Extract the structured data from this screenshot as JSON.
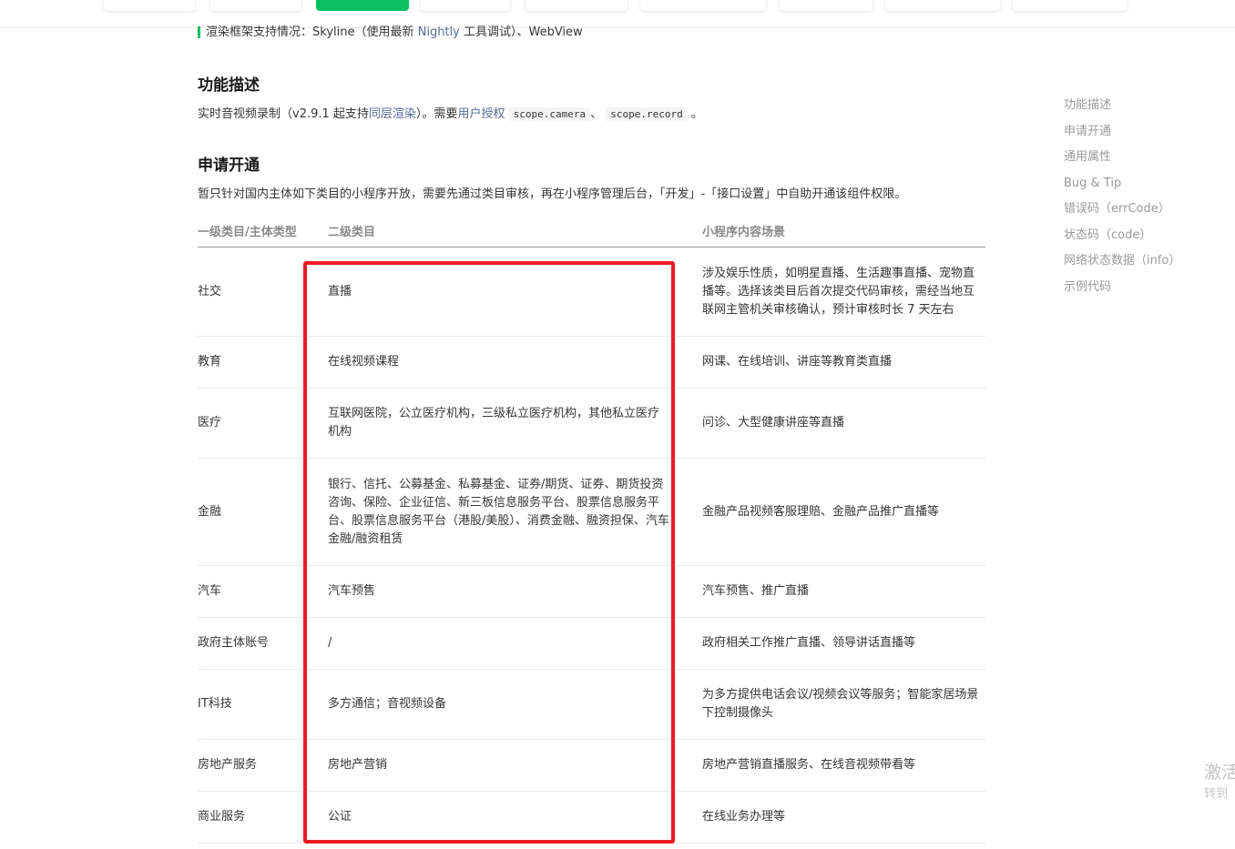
{
  "render_line": {
    "prefix": "渲染框架支持情况：Skyline（使用最新 ",
    "link": "Nightly",
    "suffix": " 工具调试）、WebView"
  },
  "section_desc": {
    "title": "功能描述",
    "text_1": "实时音视频录制（v2.9.1 起支持",
    "link_1": "同层渲染",
    "text_2": "）。需要",
    "link_2": "用户授权",
    "code_1": "scope.camera",
    "sep": "、",
    "code_2": "scope.record",
    "end": "。"
  },
  "section_apply": {
    "title": "申请开通",
    "text": "暂只针对国内主体如下类目的小程序开放，需要先通过类目审核，再在小程序管理后台，「开发」-「接口设置」中自助开通该组件权限。"
  },
  "table": {
    "headers": [
      "一级类目/主体类型",
      "二级类目",
      "小程序内容场景"
    ],
    "rows": [
      {
        "c1": "社交",
        "c2": "直播",
        "c3": "涉及娱乐性质，如明星直播、生活趣事直播、宠物直播等。选择该类目后首次提交代码审核，需经当地互联网主管机关审核确认，预计审核时长 7 天左右"
      },
      {
        "c1": "教育",
        "c2": "在线视频课程",
        "c3": "网课、在线培训、讲座等教育类直播"
      },
      {
        "c1": "医疗",
        "c2": "互联网医院，公立医疗机构，三级私立医疗机构，其他私立医疗机构",
        "c3": "问诊、大型健康讲座等直播"
      },
      {
        "c1": "金融",
        "c2": "银行、信托、公募基金、私募基金、证券/期货、证券、期货投资咨询、保险、企业征信、新三板信息服务平台、股票信息服务平台、股票信息服务平台（港股/美股）、消费金融、融资担保、汽车金融/融资租赁",
        "c3": "金融产品视频客服理赔、金融产品推广直播等"
      },
      {
        "c1": "汽车",
        "c2": "汽车预售",
        "c3": "汽车预售、推广直播"
      },
      {
        "c1": "政府主体账号",
        "c2": "/",
        "c3": "政府相关工作推广直播、领导讲话直播等"
      },
      {
        "c1": "IT科技",
        "c2": "多方通信；音视频设备",
        "c3": "为多方提供电话会议/视频会议等服务；智能家居场景下控制摄像头"
      },
      {
        "c1": "房地产服务",
        "c2": "房地产营销",
        "c3": "房地产营销直播服务、在线音视频带看等"
      },
      {
        "c1": "商业服务",
        "c2": "公证",
        "c3": "在线业务办理等"
      }
    ]
  },
  "toc": [
    "功能描述",
    "申请开通",
    "通用属性",
    "Bug & Tip",
    "错误码（errCode）",
    "状态码（code）",
    "网络状态数据（info）",
    "示例代码"
  ],
  "watermark": {
    "line1": "激活",
    "line2": "转到"
  },
  "colors": {
    "accent": "#07c160",
    "link": "#576b95",
    "highlight_box": "#ee1c24"
  }
}
